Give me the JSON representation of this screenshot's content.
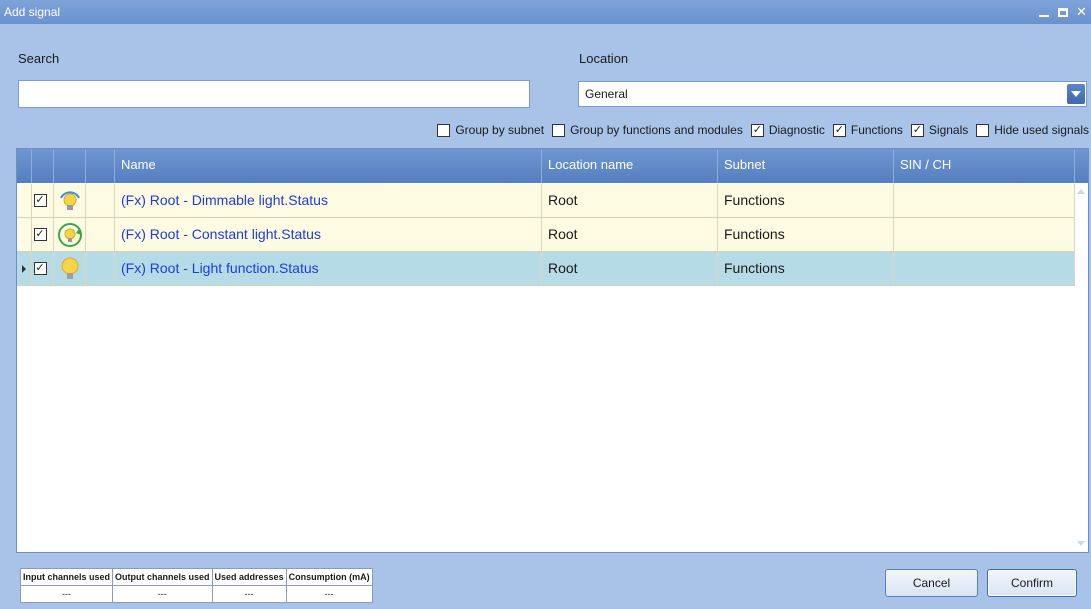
{
  "window": {
    "title": "Add signal"
  },
  "search": {
    "label": "Search",
    "value": "",
    "placeholder": ""
  },
  "location": {
    "label": "Location",
    "selected": "General"
  },
  "filters": [
    {
      "label": "Group by subnet",
      "checked": false
    },
    {
      "label": "Group by functions and modules",
      "checked": false
    },
    {
      "label": "Diagnostic",
      "checked": true
    },
    {
      "label": "Functions",
      "checked": true
    },
    {
      "label": "Signals",
      "checked": true
    },
    {
      "label": "Hide used signals",
      "checked": false
    }
  ],
  "grid": {
    "columns": [
      "Name",
      "Location name",
      "Subnet",
      "SIN / CH"
    ],
    "rows": [
      {
        "checked": true,
        "icon": "dimmable-light-icon",
        "name": "(Fx) Root - Dimmable light.Status",
        "location": "Root",
        "subnet": "Functions",
        "sin": ""
      },
      {
        "checked": true,
        "icon": "constant-light-icon",
        "name": "(Fx) Root - Constant light.Status",
        "location": "Root",
        "subnet": "Functions",
        "sin": ""
      },
      {
        "checked": true,
        "icon": "light-bulb-icon",
        "name": "(Fx) Root - Light function.Status",
        "location": "Root",
        "subnet": "Functions",
        "sin": ""
      }
    ]
  },
  "stats": {
    "headers": [
      "Input channels used",
      "Output channels used",
      "Used addresses",
      "Consumption (mA)"
    ],
    "values": [
      "---",
      "---",
      "---",
      "---"
    ]
  },
  "buttons": {
    "cancel": "Cancel",
    "confirm": "Confirm"
  }
}
